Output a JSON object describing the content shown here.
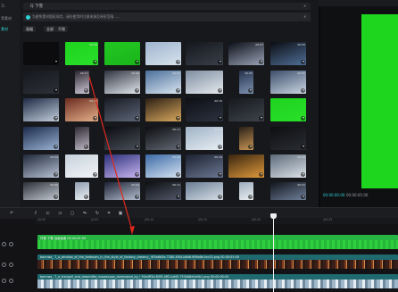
{
  "sidebar": {
    "items": [
      {
        "label": "1)"
      },
      {
        "label": "荐素材"
      },
      {
        "label": "素材"
      }
    ]
  },
  "browser": {
    "search_text": "Q 下雪",
    "notice_text": "为避免素材版权风险，请在使用时注意来源及授权范围……",
    "filters": [
      "画幅",
      "全部",
      "不限"
    ],
    "durations": [
      "",
      "00:09",
      "",
      "",
      "",
      "00:07",
      "00:05",
      "",
      "00:17",
      "00:06",
      "00:07",
      "",
      "00:05",
      "00:05",
      "",
      "00:10",
      "",
      "",
      "00:10",
      "",
      "",
      "",
      "",
      "",
      "00:11",
      "00:13",
      "",
      "",
      "00:09",
      "00:06",
      "",
      "00:06",
      "00:19",
      "",
      "00:09",
      "00:09",
      "",
      "00:04",
      "00:11",
      "",
      "",
      "00:31",
      "",
      "",
      "",
      "",
      "",
      "",
      ""
    ]
  },
  "preview": {
    "timecode_current": "00:00:00:00",
    "timecode_total": "00:00:05:00",
    "green_color": "#1fd61f"
  },
  "timeline": {
    "ruler_ticks": [
      "00:00",
      "|0:05",
      "|00:10",
      "|00:15",
      "|00:20",
      "|00:25"
    ],
    "tracks": [
      {
        "label": "外雪 下雪 远景画面  00:00:05:00"
      },
      {
        "label": "bannwa_ 7_a_window_of_the_bedroom_in_the_style_of_fantasy_dreamy_ 6f5a6d3e-7280-4f54-b8d6-f6f0e8e1ec03.png  00:00:05:00"
      },
      {
        "label": "bannwa_ 7_a_tranquil_and_dreamlike_snowscape_dominated_by_l 50e4ff3d-85f5-4ff2-bd45-7534d8e5a9b1.png  00:00:05:00"
      }
    ],
    "colors": {
      "track1": "#27b543",
      "track2": "#1e6a6e",
      "track3": "#1e6a6e",
      "accent": "#2fd1d6"
    }
  }
}
